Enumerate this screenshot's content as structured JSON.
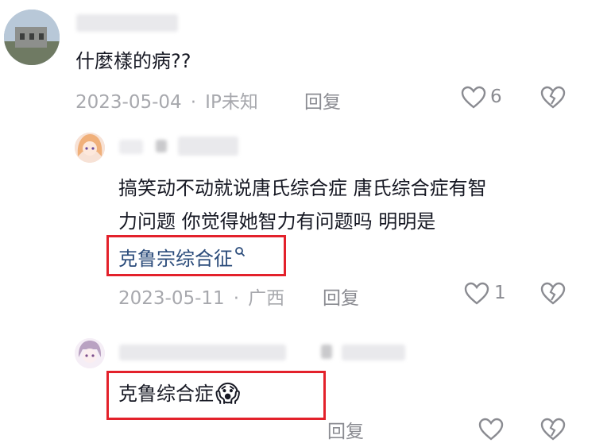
{
  "comments": [
    {
      "text": "什麼樣的病??",
      "date": "2023-05-04",
      "location": "IP未知",
      "reply_label": "回复",
      "likes": "6"
    },
    {
      "text_line1": "搞笑动不动就说唐氏综合症 唐氏综合症有智",
      "text_line2": "力问题 你觉得她智力有问题吗 明明是",
      "link_text": "克鲁宗综合征",
      "date": "2023-05-11",
      "location": "广西",
      "reply_label": "回复",
      "likes": "1"
    },
    {
      "text": "克鲁综合症",
      "emoji": "😱",
      "reply_label": "回复"
    }
  ],
  "meta_separator": "·",
  "colors": {
    "highlight_box": "#e3212b",
    "link": "#2a4b7a",
    "meta": "#a7a8ad"
  }
}
